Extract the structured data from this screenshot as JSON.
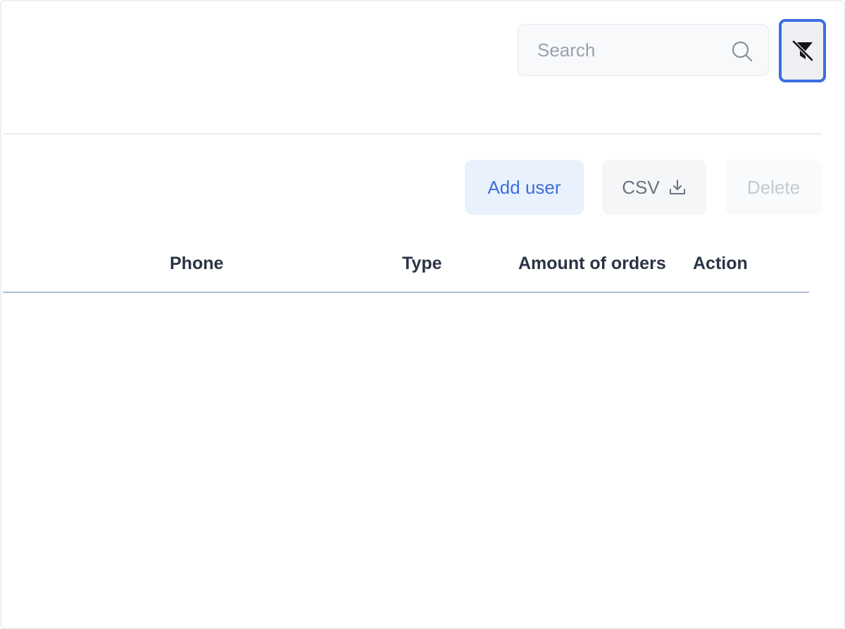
{
  "search": {
    "placeholder": "Search",
    "value": ""
  },
  "toolbar": {
    "filter_icon": "filter-off-icon",
    "add_user_label": "Add user",
    "csv_label": "CSV",
    "csv_icon": "download-icon",
    "delete_label": "Delete"
  },
  "table": {
    "columns": [
      "Phone",
      "Type",
      "Amount of orders",
      "Action"
    ],
    "rows": []
  },
  "colors": {
    "accent": "#3b6fe0",
    "add_user_bg": "#e9f1fd",
    "add_user_text": "#3d6fd8",
    "header_text": "#2b3445",
    "disabled_text": "#c4c9d1"
  }
}
